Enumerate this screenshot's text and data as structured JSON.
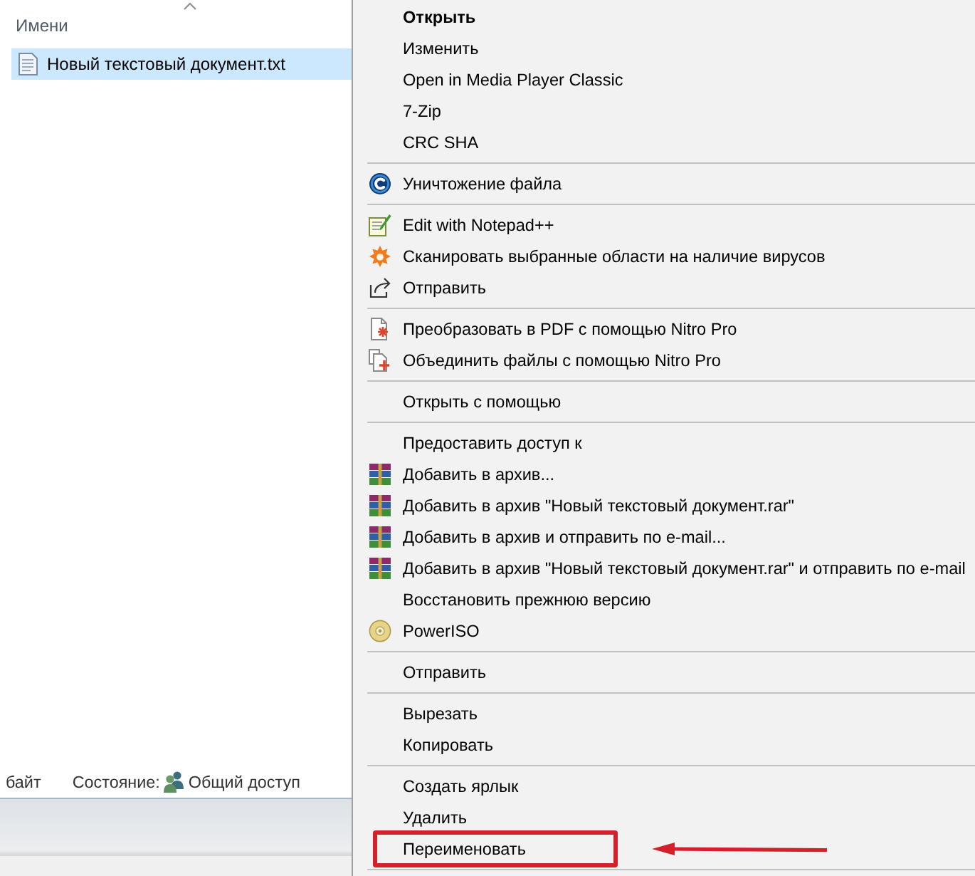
{
  "explorer": {
    "column_header": "Имени",
    "sorted": true,
    "files": [
      {
        "name": "Новый текстовый документ.txt",
        "selected": true
      }
    ],
    "status_bar": {
      "size": "байт",
      "state_label": "Состояние:",
      "state_value": "Общий доступ"
    }
  },
  "context_menu": {
    "groups": [
      {
        "items": [
          {
            "kind": "plain",
            "label": "Открыть",
            "default": true,
            "highlighted": false
          },
          {
            "kind": "plain",
            "label": "Изменить",
            "default": false,
            "highlighted": false
          },
          {
            "kind": "plain",
            "label": "Open in Media Player Classic",
            "default": false,
            "highlighted": false
          },
          {
            "kind": "plain",
            "label": "7-Zip",
            "default": false,
            "highlighted": false
          },
          {
            "kind": "plain",
            "label": "CRC SHA",
            "default": false,
            "highlighted": false
          }
        ]
      },
      {
        "items": [
          {
            "kind": "shredder",
            "label": "Уничтожение файла",
            "default": false,
            "highlighted": false
          }
        ]
      },
      {
        "items": [
          {
            "kind": "notepad",
            "label": "Edit with Notepad++",
            "default": false,
            "highlighted": false
          },
          {
            "kind": "antivirus",
            "label": "Сканировать выбранные области на наличие вирусов",
            "default": false,
            "highlighted": false
          },
          {
            "kind": "share",
            "label": "Отправить",
            "default": false,
            "highlighted": false
          }
        ]
      },
      {
        "items": [
          {
            "kind": "convert",
            "label": "Преобразовать в PDF с помощью Nitro Pro",
            "default": false,
            "highlighted": false
          },
          {
            "kind": "combine",
            "label": "Объединить файлы с помощью Nitro Pro",
            "default": false,
            "highlighted": false
          }
        ]
      },
      {
        "items": [
          {
            "kind": "plain",
            "label": "Открыть с помощью",
            "default": false,
            "highlighted": false
          }
        ]
      },
      {
        "items": [
          {
            "kind": "plain",
            "label": "Предоставить доступ к",
            "default": false,
            "highlighted": false
          },
          {
            "kind": "archiver",
            "label": "Добавить в архив...",
            "default": false,
            "highlighted": false
          },
          {
            "kind": "archiver",
            "label": "Добавить в архив \"Новый текстовый документ.rar\"",
            "default": false,
            "highlighted": false
          },
          {
            "kind": "archiver",
            "label": "Добавить в архив и отправить по e-mail...",
            "default": false,
            "highlighted": false
          },
          {
            "kind": "archiver",
            "label": "Добавить в архив \"Новый текстовый документ.rar\" и отправить по e-mail",
            "default": false,
            "highlighted": false
          },
          {
            "kind": "plain",
            "label": "Восстановить прежнюю версию",
            "default": false,
            "highlighted": false
          },
          {
            "kind": "disc",
            "label": "PowerISO",
            "default": false,
            "highlighted": false
          }
        ]
      },
      {
        "items": [
          {
            "kind": "plain",
            "label": "Отправить",
            "default": false,
            "highlighted": false
          }
        ]
      },
      {
        "items": [
          {
            "kind": "plain",
            "label": "Вырезать",
            "default": false,
            "highlighted": false
          },
          {
            "kind": "plain",
            "label": "Копировать",
            "default": false,
            "highlighted": false
          }
        ]
      },
      {
        "items": [
          {
            "kind": "plain",
            "label": "Создать ярлык",
            "default": false,
            "highlighted": false
          },
          {
            "kind": "plain",
            "label": "Удалить",
            "default": false,
            "highlighted": false
          },
          {
            "kind": "plain",
            "label": "Переименовать",
            "default": false,
            "highlighted": true
          }
        ]
      }
    ]
  }
}
